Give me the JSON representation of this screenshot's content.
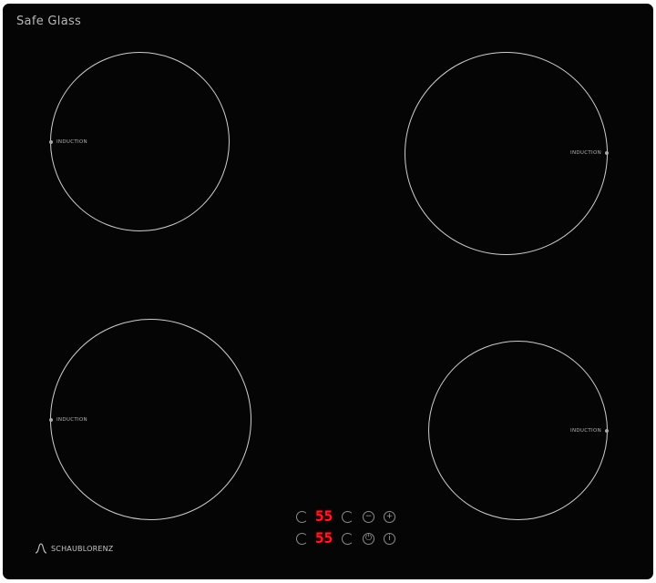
{
  "appliance": {
    "coating_label": "Safe Glass",
    "zone_label": "INDUCTION",
    "display_top": "55",
    "display_bottom": "55",
    "brand": "SCHAUBLORENZ",
    "colors": {
      "glass": "#050505",
      "ring": "#cfcfcf",
      "display_red": "#ff1b25"
    }
  },
  "icons": [
    "timer-icon",
    "power-icon",
    "minus-icon",
    "plus-icon",
    "lock-icon",
    "info-icon"
  ]
}
